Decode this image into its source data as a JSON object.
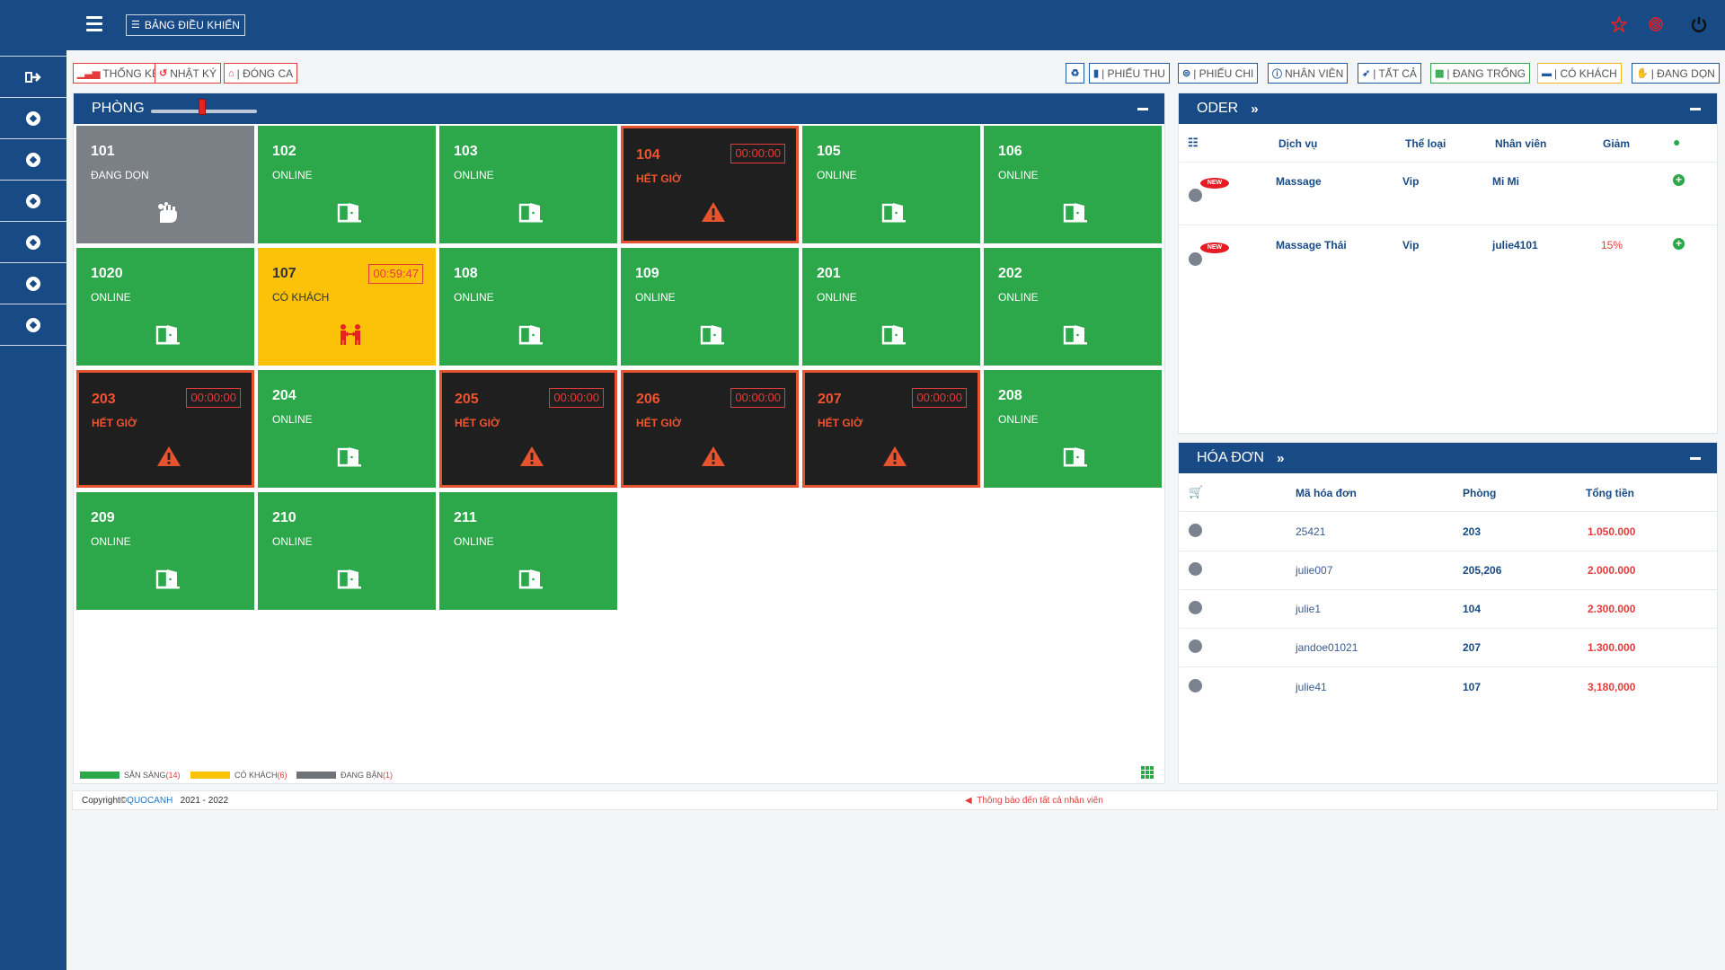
{
  "header": {
    "dashboard_label": "BẢNG ĐIỀU KHIỂN"
  },
  "toolbar": {
    "thong_ke": "THỐNG KÊ",
    "nhat_ky": "NHẬT KÝ",
    "dong_ca": "| ĐÓNG CA",
    "phieu_thu": "| PHIẾU THU",
    "phieu_chi": "| PHIẾU CHI",
    "nhan_vien": "NHÂN VIÊN",
    "tat_ca": "| TẤT CẢ",
    "dang_trong": "| ĐANG TRỐNG",
    "co_khach": "| CÓ KHÁCH",
    "dang_don": "| ĐANG DỌN"
  },
  "rooms_panel": {
    "title": "PHÒNG",
    "slider_fraction": 0.45,
    "rooms": [
      {
        "number": "101",
        "status": "ĐANG DỌN",
        "state": "clean",
        "timer": ""
      },
      {
        "number": "102",
        "status": "ONLINE",
        "state": "online",
        "timer": ""
      },
      {
        "number": "103",
        "status": "ONLINE",
        "state": "online",
        "timer": ""
      },
      {
        "number": "104",
        "status": "HẾT GIỜ",
        "state": "expired",
        "timer": "00:00:00"
      },
      {
        "number": "105",
        "status": "ONLINE",
        "state": "online",
        "timer": ""
      },
      {
        "number": "106",
        "status": "ONLINE",
        "state": "online",
        "timer": ""
      },
      {
        "number": "1020",
        "status": "ONLINE",
        "state": "online",
        "timer": ""
      },
      {
        "number": "107",
        "status": "CÓ KHÁCH",
        "state": "busy",
        "timer": "00:59:47"
      },
      {
        "number": "108",
        "status": "ONLINE",
        "state": "online",
        "timer": ""
      },
      {
        "number": "109",
        "status": "ONLINE",
        "state": "online",
        "timer": ""
      },
      {
        "number": "201",
        "status": "ONLINE",
        "state": "online",
        "timer": ""
      },
      {
        "number": "202",
        "status": "ONLINE",
        "state": "online",
        "timer": ""
      },
      {
        "number": "203",
        "status": "HẾT GIỜ",
        "state": "expired",
        "timer": "00:00:00"
      },
      {
        "number": "204",
        "status": "ONLINE",
        "state": "online",
        "timer": ""
      },
      {
        "number": "205",
        "status": "HẾT GIỜ",
        "state": "expired",
        "timer": "00:00:00"
      },
      {
        "number": "206",
        "status": "HẾT GIỜ",
        "state": "expired",
        "timer": "00:00:00"
      },
      {
        "number": "207",
        "status": "HẾT GIỜ",
        "state": "expired",
        "timer": "00:00:00"
      },
      {
        "number": "208",
        "status": "ONLINE",
        "state": "online",
        "timer": ""
      },
      {
        "number": "209",
        "status": "ONLINE",
        "state": "online",
        "timer": ""
      },
      {
        "number": "210",
        "status": "ONLINE",
        "state": "online",
        "timer": ""
      },
      {
        "number": "211",
        "status": "ONLINE",
        "state": "online",
        "timer": ""
      }
    ],
    "legend": [
      {
        "label": "SẴN SÀNG",
        "count": "(14)",
        "color": "#2ca84a"
      },
      {
        "label": "CÓ KHÁCH",
        "count": "(6)",
        "color": "#fbc207"
      },
      {
        "label": "ĐANG BẬN",
        "count": "(1)",
        "color": "#6f747b"
      }
    ]
  },
  "order_panel": {
    "title": "ODER",
    "headers": {
      "service": "Dịch vụ",
      "type": "Thể loại",
      "staff": "Nhân viên",
      "discount": "Giảm"
    },
    "new_badge": "NEW",
    "rows": [
      {
        "service": "Massage",
        "type": "Vip",
        "staff": "Mi Mi",
        "discount": ""
      },
      {
        "service": "Massage Thái",
        "type": "Vip",
        "staff": "julie4101",
        "discount": "15%"
      }
    ]
  },
  "invoice_panel": {
    "title": "HÓA ĐƠN",
    "headers": {
      "code": "Mã hóa đơn",
      "room": "Phòng",
      "total": "Tổng tiền"
    },
    "rows": [
      {
        "code": "25421",
        "room": "203",
        "total": "1.050.000"
      },
      {
        "code": "julie007",
        "room": "205,206",
        "total": "2.000.000"
      },
      {
        "code": "julie1",
        "room": "104",
        "total": "2.300.000"
      },
      {
        "code": "jandoe01021",
        "room": "207",
        "total": "1.300.000"
      },
      {
        "code": "julie41",
        "room": "107",
        "total": "3,180,000"
      }
    ]
  },
  "footer": {
    "copyright": "Copyright©",
    "brand": "QUOCANH",
    "years": "2021 - 2022",
    "notice": "Thông báo đến tất cả nhân viên"
  },
  "colors": {
    "primary": "#184a85",
    "online": "#2ca84a",
    "busy": "#fbc207",
    "expired_bg": "#1f1f1f",
    "alert": "#e5532f",
    "clean": "#7b7f86"
  }
}
